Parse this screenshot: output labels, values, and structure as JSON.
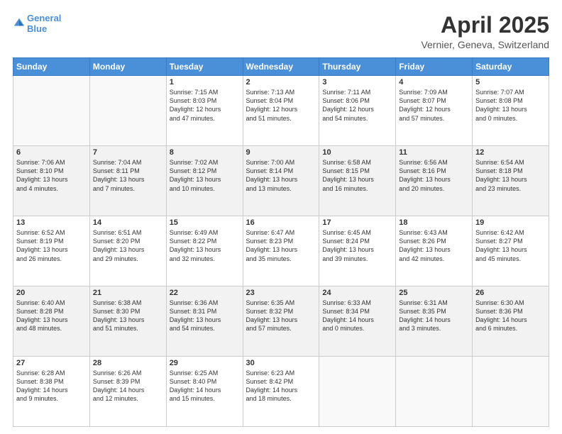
{
  "header": {
    "logo_line1": "General",
    "logo_line2": "Blue",
    "month": "April 2025",
    "location": "Vernier, Geneva, Switzerland"
  },
  "days_of_week": [
    "Sunday",
    "Monday",
    "Tuesday",
    "Wednesday",
    "Thursday",
    "Friday",
    "Saturday"
  ],
  "weeks": [
    [
      {
        "day": "",
        "info": ""
      },
      {
        "day": "",
        "info": ""
      },
      {
        "day": "1",
        "info": "Sunrise: 7:15 AM\nSunset: 8:03 PM\nDaylight: 12 hours\nand 47 minutes."
      },
      {
        "day": "2",
        "info": "Sunrise: 7:13 AM\nSunset: 8:04 PM\nDaylight: 12 hours\nand 51 minutes."
      },
      {
        "day": "3",
        "info": "Sunrise: 7:11 AM\nSunset: 8:06 PM\nDaylight: 12 hours\nand 54 minutes."
      },
      {
        "day": "4",
        "info": "Sunrise: 7:09 AM\nSunset: 8:07 PM\nDaylight: 12 hours\nand 57 minutes."
      },
      {
        "day": "5",
        "info": "Sunrise: 7:07 AM\nSunset: 8:08 PM\nDaylight: 13 hours\nand 0 minutes."
      }
    ],
    [
      {
        "day": "6",
        "info": "Sunrise: 7:06 AM\nSunset: 8:10 PM\nDaylight: 13 hours\nand 4 minutes."
      },
      {
        "day": "7",
        "info": "Sunrise: 7:04 AM\nSunset: 8:11 PM\nDaylight: 13 hours\nand 7 minutes."
      },
      {
        "day": "8",
        "info": "Sunrise: 7:02 AM\nSunset: 8:12 PM\nDaylight: 13 hours\nand 10 minutes."
      },
      {
        "day": "9",
        "info": "Sunrise: 7:00 AM\nSunset: 8:14 PM\nDaylight: 13 hours\nand 13 minutes."
      },
      {
        "day": "10",
        "info": "Sunrise: 6:58 AM\nSunset: 8:15 PM\nDaylight: 13 hours\nand 16 minutes."
      },
      {
        "day": "11",
        "info": "Sunrise: 6:56 AM\nSunset: 8:16 PM\nDaylight: 13 hours\nand 20 minutes."
      },
      {
        "day": "12",
        "info": "Sunrise: 6:54 AM\nSunset: 8:18 PM\nDaylight: 13 hours\nand 23 minutes."
      }
    ],
    [
      {
        "day": "13",
        "info": "Sunrise: 6:52 AM\nSunset: 8:19 PM\nDaylight: 13 hours\nand 26 minutes."
      },
      {
        "day": "14",
        "info": "Sunrise: 6:51 AM\nSunset: 8:20 PM\nDaylight: 13 hours\nand 29 minutes."
      },
      {
        "day": "15",
        "info": "Sunrise: 6:49 AM\nSunset: 8:22 PM\nDaylight: 13 hours\nand 32 minutes."
      },
      {
        "day": "16",
        "info": "Sunrise: 6:47 AM\nSunset: 8:23 PM\nDaylight: 13 hours\nand 35 minutes."
      },
      {
        "day": "17",
        "info": "Sunrise: 6:45 AM\nSunset: 8:24 PM\nDaylight: 13 hours\nand 39 minutes."
      },
      {
        "day": "18",
        "info": "Sunrise: 6:43 AM\nSunset: 8:26 PM\nDaylight: 13 hours\nand 42 minutes."
      },
      {
        "day": "19",
        "info": "Sunrise: 6:42 AM\nSunset: 8:27 PM\nDaylight: 13 hours\nand 45 minutes."
      }
    ],
    [
      {
        "day": "20",
        "info": "Sunrise: 6:40 AM\nSunset: 8:28 PM\nDaylight: 13 hours\nand 48 minutes."
      },
      {
        "day": "21",
        "info": "Sunrise: 6:38 AM\nSunset: 8:30 PM\nDaylight: 13 hours\nand 51 minutes."
      },
      {
        "day": "22",
        "info": "Sunrise: 6:36 AM\nSunset: 8:31 PM\nDaylight: 13 hours\nand 54 minutes."
      },
      {
        "day": "23",
        "info": "Sunrise: 6:35 AM\nSunset: 8:32 PM\nDaylight: 13 hours\nand 57 minutes."
      },
      {
        "day": "24",
        "info": "Sunrise: 6:33 AM\nSunset: 8:34 PM\nDaylight: 14 hours\nand 0 minutes."
      },
      {
        "day": "25",
        "info": "Sunrise: 6:31 AM\nSunset: 8:35 PM\nDaylight: 14 hours\nand 3 minutes."
      },
      {
        "day": "26",
        "info": "Sunrise: 6:30 AM\nSunset: 8:36 PM\nDaylight: 14 hours\nand 6 minutes."
      }
    ],
    [
      {
        "day": "27",
        "info": "Sunrise: 6:28 AM\nSunset: 8:38 PM\nDaylight: 14 hours\nand 9 minutes."
      },
      {
        "day": "28",
        "info": "Sunrise: 6:26 AM\nSunset: 8:39 PM\nDaylight: 14 hours\nand 12 minutes."
      },
      {
        "day": "29",
        "info": "Sunrise: 6:25 AM\nSunset: 8:40 PM\nDaylight: 14 hours\nand 15 minutes."
      },
      {
        "day": "30",
        "info": "Sunrise: 6:23 AM\nSunset: 8:42 PM\nDaylight: 14 hours\nand 18 minutes."
      },
      {
        "day": "",
        "info": ""
      },
      {
        "day": "",
        "info": ""
      },
      {
        "day": "",
        "info": ""
      }
    ]
  ]
}
